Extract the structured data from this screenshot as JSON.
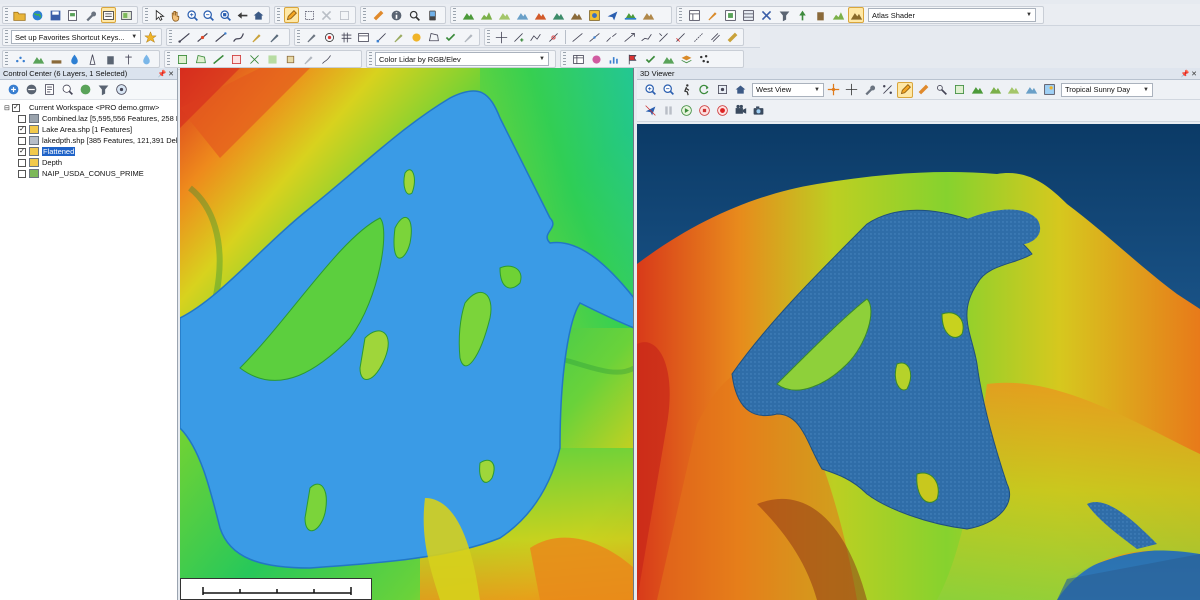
{
  "toolbars": {
    "shader_label": "Atlas Shader",
    "favorites_label": "Set up Favorites Shortcut Keys...",
    "lidar_color_label": "Color Lidar by RGB/Elev"
  },
  "control_center": {
    "title": "Control Center (6 Layers, 1 Selected)",
    "workspace_label": "Current Workspace <PRO demo.gmw>",
    "layers": [
      {
        "label": "Combined.laz [5,595,556 Features, 258 Le",
        "checked": false,
        "icon": "lidar-layer-icon"
      },
      {
        "label": "Lake Area.shp [1 Features]",
        "checked": true,
        "icon": "area-layer-icon"
      },
      {
        "label": "lakedpth.shp [385 Features, 121,391 Del",
        "checked": false,
        "icon": "vector-layer-icon"
      },
      {
        "label": "Flattened",
        "checked": true,
        "icon": "raster-layer-icon",
        "selected": true
      },
      {
        "label": "Depth",
        "checked": false,
        "icon": "raster-layer-icon"
      },
      {
        "label": "NAIP_USDA_CONUS_PRIME",
        "checked": false,
        "icon": "imagery-layer-icon"
      }
    ]
  },
  "viewer3d": {
    "title": "3D Viewer",
    "view_label": "West View",
    "sky_label": "Tropical Sunny Day"
  },
  "colors": {
    "water": "#3a9be6",
    "selection": "#1f63c8",
    "sky_top": "#0b3a66",
    "sky_bottom": "#2f78b8"
  }
}
